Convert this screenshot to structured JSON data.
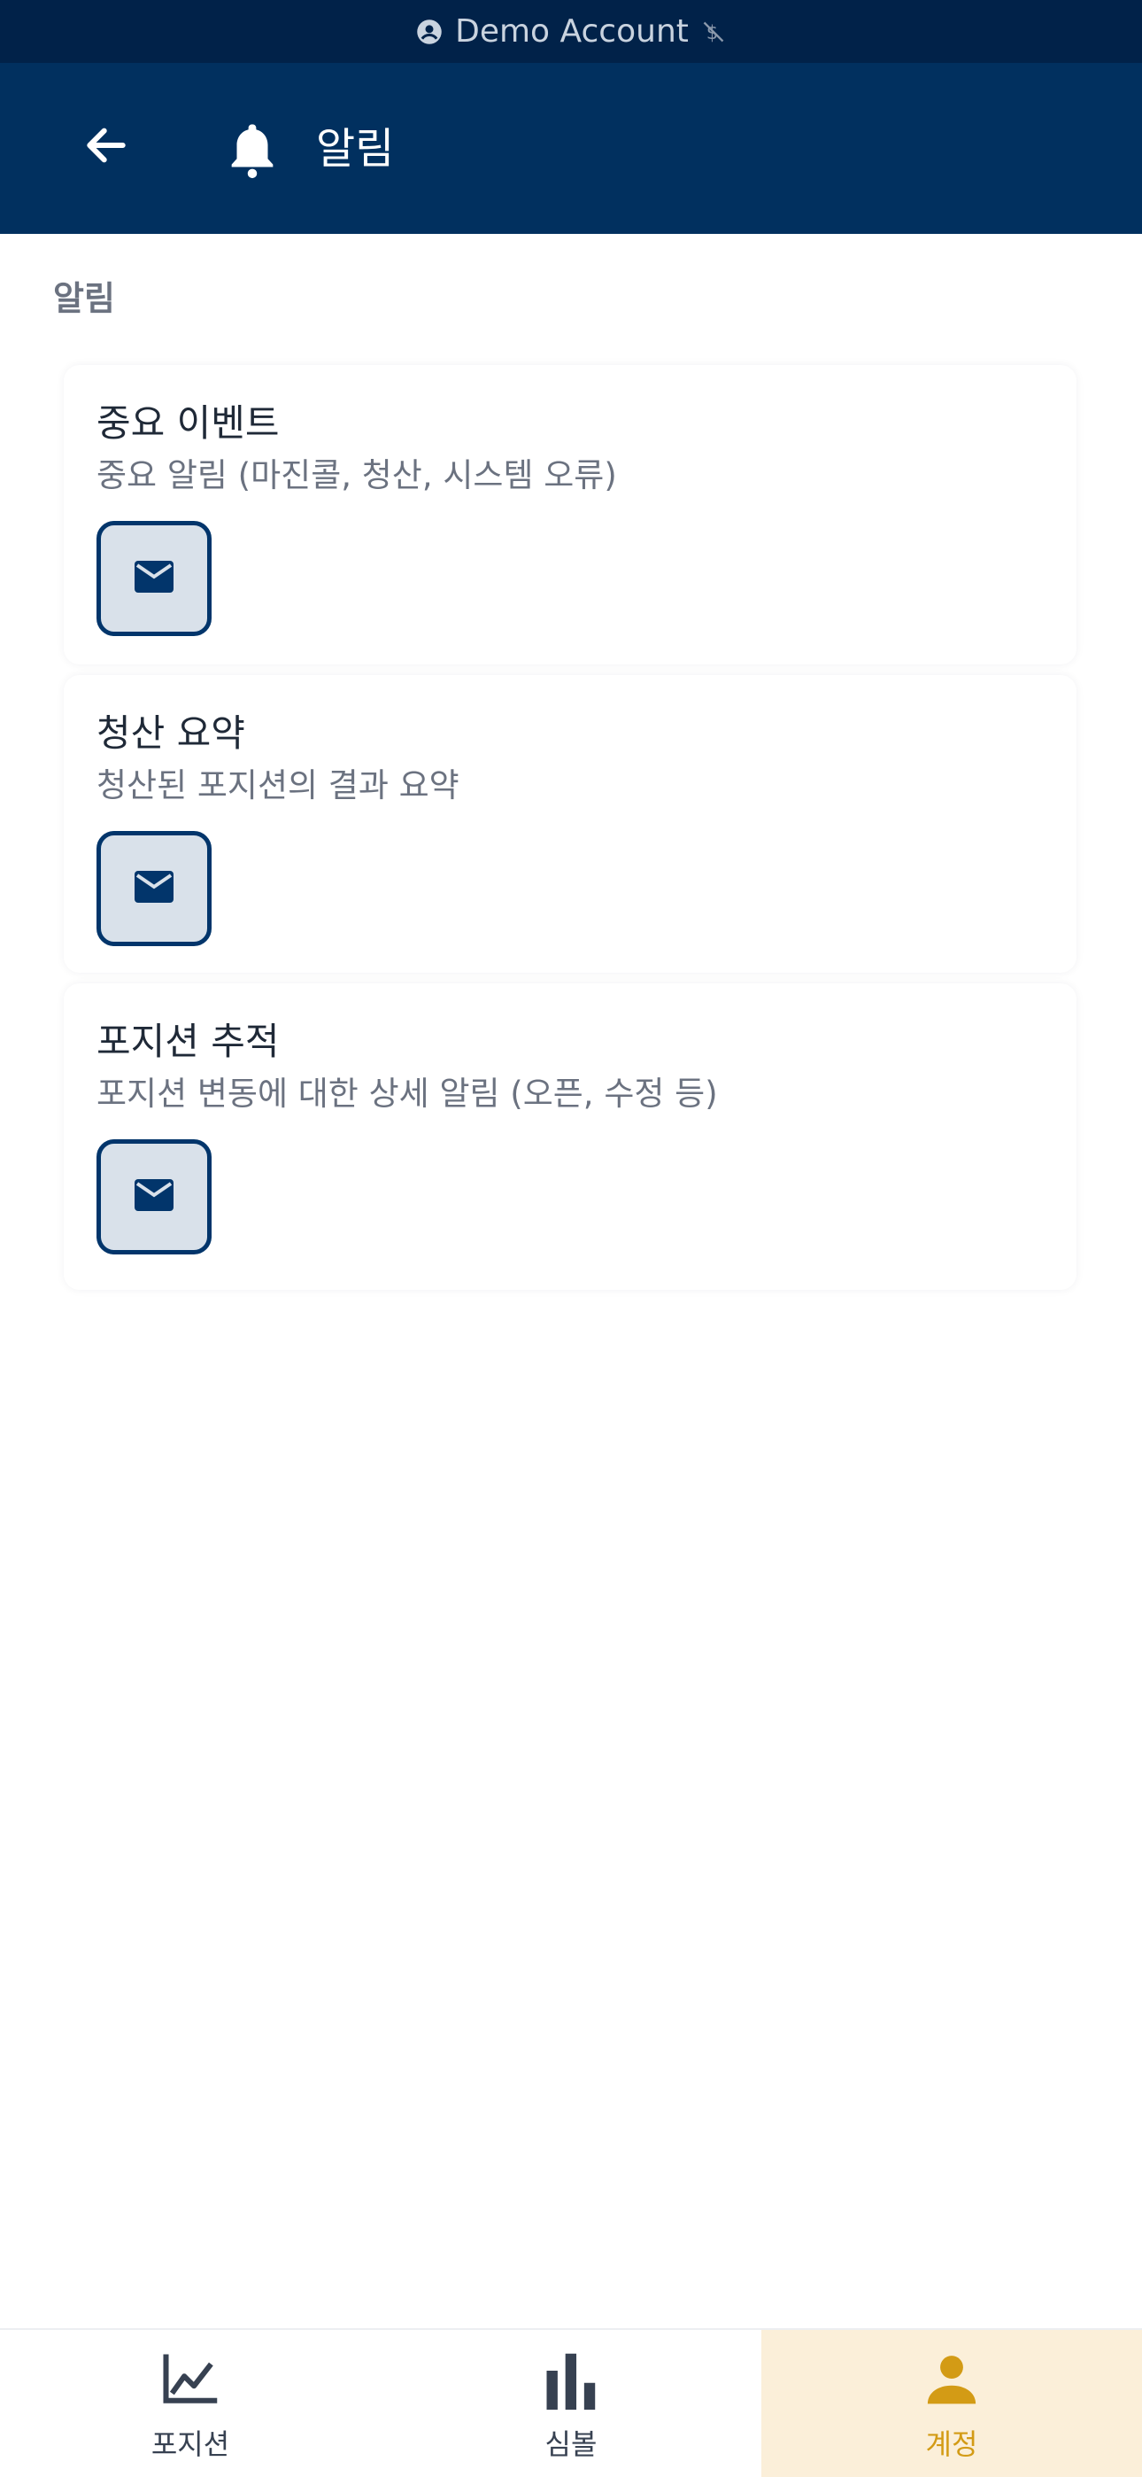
{
  "status_bar": {
    "account_label": "Demo Account"
  },
  "header": {
    "title": "알림"
  },
  "section": {
    "label": "알림"
  },
  "cards": [
    {
      "title": "중요 이벤트",
      "description": "중요 알림 (마진콜, 청산, 시스템 오류)",
      "email_enabled": true
    },
    {
      "title": "청산 요약",
      "description": "청산된 포지션의 결과 요약",
      "email_enabled": true
    },
    {
      "title": "포지션 추적",
      "description": "포지션 변동에 대한 상세 알림 (오픈, 수정 등)",
      "email_enabled": true
    }
  ],
  "bottom_nav": {
    "items": [
      {
        "label": "포지션",
        "icon": "line-chart-icon"
      },
      {
        "label": "심볼",
        "icon": "bar-chart-icon"
      },
      {
        "label": "계정",
        "icon": "person-icon",
        "active": true
      }
    ]
  },
  "colors": {
    "primary": "#01305f",
    "accent": "#d39b15",
    "demo_bar": "#012249"
  }
}
